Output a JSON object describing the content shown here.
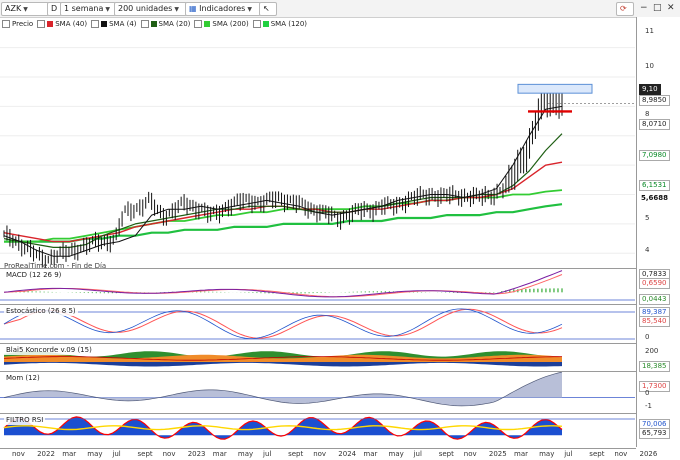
{
  "toolbar": {
    "ticker": "AZK",
    "d_label": "D",
    "period": "1 semana",
    "units": "200 unidades",
    "indicators_label": "Indicadores",
    "window_buttons": [
      "−",
      "□",
      "✕"
    ]
  },
  "legend": [
    {
      "label": "Precio",
      "color": "#ffffff"
    },
    {
      "label": "SMA (40)",
      "color": "#d9242b"
    },
    {
      "label": "SMA (4)",
      "color": "#111111"
    },
    {
      "label": "SMA (20)",
      "color": "#1f5f14"
    },
    {
      "label": "SMA (200)",
      "color": "#33cc33"
    },
    {
      "label": "SMA (120)",
      "color": "#20d040"
    }
  ],
  "watermark": "ProRealTime.com - Fin de Día",
  "panels": {
    "macd": "MACD (12 26 9)",
    "stoch": "Estocástico (26 8 5)",
    "blai": "Blai5 Koncorde v.09 (15)",
    "mom": "Mom (12)",
    "rsi": "FILTRO RSI"
  },
  "price_axis": {
    "ticks": [
      "11",
      "10",
      "9",
      "8",
      "7",
      "6",
      "5",
      "4"
    ],
    "tags": [
      "9,10",
      "8,9850",
      "8,0710",
      "7,0980",
      "6,1531",
      "5,6688"
    ]
  },
  "macd_axis": {
    "tags": [
      "0,7833",
      "0,6590",
      "0,0443"
    ]
  },
  "stoch_axis": {
    "ticks": [
      "100",
      "0"
    ],
    "tags": [
      "89,387",
      "85,540"
    ]
  },
  "blai_axis": {
    "ticks": [
      "200",
      "0"
    ],
    "tags": [
      "18,385"
    ]
  },
  "mom_axis": {
    "ticks": [
      "2",
      "0",
      "-1"
    ],
    "tags": [
      "1,7300"
    ]
  },
  "rsi_axis": {
    "tags": [
      "70,006",
      "65,793"
    ]
  },
  "x_axis": [
    "nov",
    "2022",
    "mar",
    "may",
    "jul",
    "sept",
    "nov",
    "2023",
    "mar",
    "may",
    "jul",
    "sept",
    "nov",
    "2024",
    "mar",
    "may",
    "jul",
    "sept",
    "nov",
    "2025",
    "mar",
    "may",
    "jul",
    "sept",
    "nov",
    "2026"
  ],
  "chart_data": {
    "type": "line",
    "title": "AZK",
    "price_range": [
      3.5,
      11.6
    ],
    "close_weekly_samples": [
      4.6,
      4.5,
      4.3,
      4.1,
      3.9,
      3.8,
      3.9,
      4.0,
      4.1,
      4.2,
      4.3,
      4.4,
      4.4,
      4.5,
      5.4,
      5.5,
      5.6,
      5.8,
      5.4,
      5.3,
      5.5,
      5.7,
      5.6,
      5.5,
      5.3,
      5.4,
      5.6,
      5.7,
      5.8,
      5.8,
      5.7,
      5.8,
      5.9,
      5.8,
      5.7,
      5.6,
      5.5,
      5.4,
      5.3,
      5.2,
      5.3,
      5.4,
      5.5,
      5.5,
      5.6,
      5.6,
      5.7,
      5.8,
      5.9,
      6.0,
      6.0,
      5.9,
      6.0,
      6.0,
      5.9,
      5.9,
      6.0,
      6.0,
      6.1,
      6.5,
      7.1,
      7.4,
      8.5,
      9.3,
      9.2,
      9.1
    ],
    "series": [
      {
        "name": "SMA (4)",
        "values": [
          4.6,
          4.4,
          4.1,
          3.9,
          3.9,
          4.1,
          4.3,
          4.4,
          4.6,
          5.3,
          5.5,
          5.5,
          5.6,
          5.5,
          5.6,
          5.7,
          5.8,
          5.7,
          5.6,
          5.4,
          5.3,
          5.4,
          5.5,
          5.6,
          5.8,
          5.9,
          6.0,
          6.0,
          5.9,
          6.0,
          6.2,
          7.0,
          8.0,
          8.9,
          9.0
        ]
      },
      {
        "name": "SMA (20)",
        "values": [
          4.5,
          4.4,
          4.3,
          4.2,
          4.2,
          4.3,
          4.6,
          4.8,
          5.0,
          5.1,
          5.2,
          5.3,
          5.4,
          5.5,
          5.5,
          5.6,
          5.6,
          5.6,
          5.5,
          5.4,
          5.4,
          5.4,
          5.5,
          5.6,
          5.7,
          5.8,
          5.9,
          5.9,
          5.9,
          6.0,
          6.0,
          6.3,
          6.8,
          7.5,
          8.07
        ]
      },
      {
        "name": "SMA (40)",
        "values": [
          4.7,
          4.6,
          4.5,
          4.4,
          4.4,
          4.5,
          4.6,
          4.7,
          4.9,
          5.0,
          5.1,
          5.2,
          5.3,
          5.4,
          5.5,
          5.5,
          5.6,
          5.6,
          5.5,
          5.5,
          5.4,
          5.4,
          5.5,
          5.5,
          5.6,
          5.7,
          5.8,
          5.8,
          5.9,
          5.9,
          6.0,
          6.2,
          6.6,
          7.0,
          7.1
        ]
      },
      {
        "name": "SMA (120)",
        "values": [
          4.4,
          4.4,
          4.4,
          4.5,
          4.5,
          4.6,
          4.7,
          4.8,
          4.9,
          5.0,
          5.1,
          5.1,
          5.2,
          5.3,
          5.3,
          5.4,
          5.4,
          5.5,
          5.5,
          5.5,
          5.5,
          5.5,
          5.6,
          5.6,
          5.7,
          5.7,
          5.8,
          5.8,
          5.9,
          5.9,
          5.9,
          6.0,
          6.0,
          6.1,
          6.15
        ]
      },
      {
        "name": "SMA (200)",
        "values": [
          4.4,
          4.4,
          4.4,
          4.4,
          4.4,
          4.5,
          4.5,
          4.6,
          4.6,
          4.7,
          4.7,
          4.8,
          4.8,
          4.8,
          4.9,
          4.9,
          4.9,
          5.0,
          5.0,
          5.0,
          5.0,
          5.1,
          5.1,
          5.1,
          5.2,
          5.2,
          5.2,
          5.3,
          5.3,
          5.3,
          5.4,
          5.4,
          5.5,
          5.6,
          5.67
        ]
      }
    ],
    "last_price": 9.1
  },
  "colors": {
    "sma40": "#d9242b",
    "sma4": "#111111",
    "sma20": "#1f5f14",
    "sma120": "#33cc33",
    "sma200": "#20c040",
    "macd_line": "#7a1fa2",
    "macd_signal": "#ff6666",
    "macd_hist": "#33aa33",
    "stoch_k": "#2255cc",
    "stoch_d": "#ff5555",
    "mom_fill": "#b8bfd8",
    "rsi_line": "#ff0000",
    "rsi_fill": "#1b4fd0",
    "rsi_yellow": "#ffd700"
  }
}
